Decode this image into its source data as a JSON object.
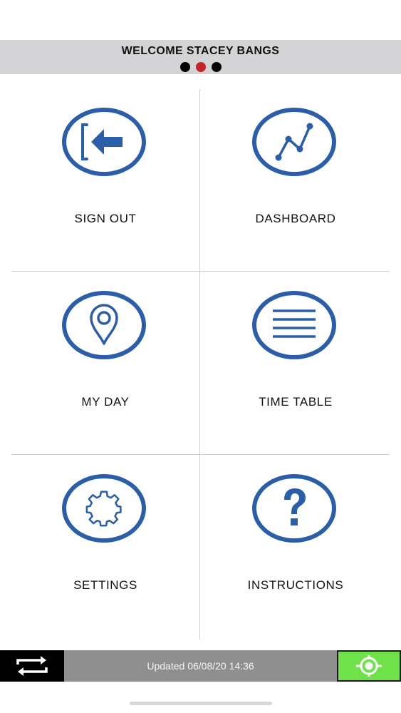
{
  "header": {
    "title": "WELCOME STACEY BANGS",
    "page_indicator": {
      "count": 3,
      "active_index": 1
    }
  },
  "menu": {
    "tiles": [
      {
        "label": "SIGN OUT",
        "icon": "sign-out-icon"
      },
      {
        "label": "DASHBOARD",
        "icon": "line-chart-icon"
      },
      {
        "label": "MY DAY",
        "icon": "map-pin-icon"
      },
      {
        "label": "TIME TABLE",
        "icon": "list-lines-icon"
      },
      {
        "label": "SETTINGS",
        "icon": "gear-icon"
      },
      {
        "label": "INSTRUCTIONS",
        "icon": "question-icon"
      }
    ]
  },
  "footer": {
    "updated_text": "Updated 06/08/20 14:36",
    "sync_icon": "sync-arrows-icon",
    "location_icon": "location-target-icon"
  },
  "colors": {
    "accent_blue": "#2b5ea9",
    "header_bg": "#d4d4d6",
    "footer_bg": "#8f8f8f",
    "location_green": "#6fe24a",
    "indicator_active": "#c0262c"
  }
}
